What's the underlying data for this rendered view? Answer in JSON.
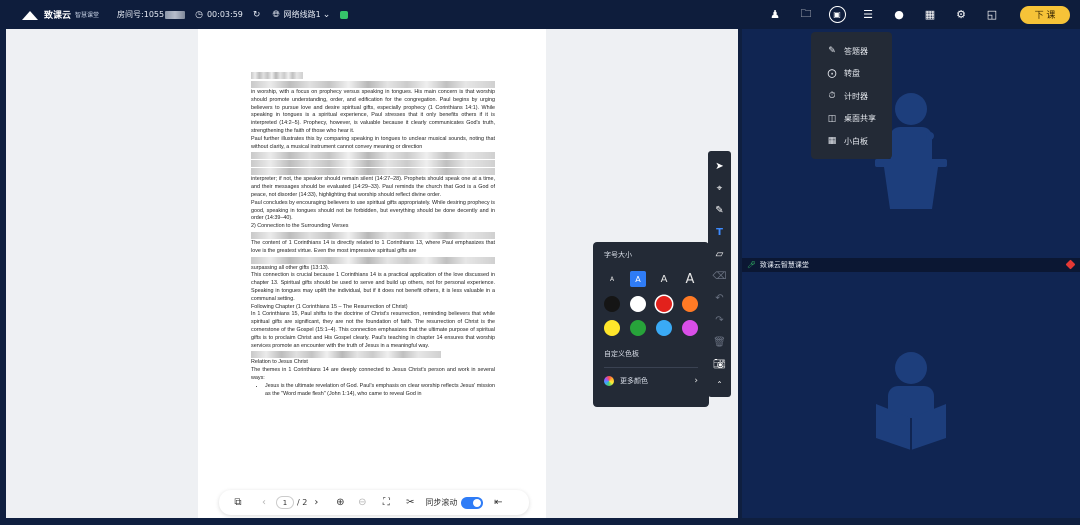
{
  "topbar": {
    "app_name": "致课云",
    "app_subtitle": "智慧课堂",
    "room_label": "房间号:1055",
    "timer": "00:03:59",
    "network_label": "网络线路1",
    "end_button": "下 课",
    "end_button_color": "#f6c338"
  },
  "document": {
    "paragraphs": [
      "in worship, with a focus on prophecy versus speaking in tongues. His main concern is that worship should promote understanding, order, and edification for the congregation. Paul begins by urging believers to pursue love and desire spiritual gifts, especially prophecy (1 Corinthians 14:1). While speaking in tongues is a spiritual experience, Paul stresses that it only benefits others if it is interpreted (14:2–5). Prophecy, however, is valuable because it clearly communicates God's truth, strengthening the faith of those who hear it.",
      "Paul further illustrates this by comparing speaking in tongues to unclear musical sounds, noting that without clarity, a musical instrument cannot convey meaning or direction",
      "interpreter; if not, the speaker should remain silent (14:27–28). Prophets should speak one at a time, and their messages should be evaluated (14:29–33). Paul reminds the church that God is a God of peace, not disorder (14:33), highlighting that worship should reflect divine order.",
      "Paul concludes by encouraging believers to use spiritual gifts appropriately. While desiring prophecy is good, speaking in tongues should not be forbidden, but everything should be done decently and in order (14:39–40).",
      "2) Connection to the Surrounding Verses",
      "The content of 1 Corinthians 14 is directly related to 1 Corinthians 13, where Paul emphasizes that love is the greatest virtue. Even the most impressive spiritual gifts are",
      "surpassing all other gifts (13:13).",
      "This connection is crucial because 1 Corinthians 14 is a practical application of the love discussed in chapter 13. Spiritual gifts should be used to serve and build up others, not for personal experience. Speaking in tongues may uplift the individual, but if it does not benefit others, it is less valuable in a communal setting.",
      "Following Chapter (1 Corinthians 15 – The Resurrection of Christ)",
      "In 1 Corinthians 15, Paul shifts to the doctrine of Christ's resurrection, reminding believers that while spiritual gifts are significant, they are not the foundation of faith. The resurrection of Christ is the cornerstone of the Gospel (15:1–4). This connection emphasizes that the ultimate purpose of spiritual gifts is to proclaim Christ and His Gospel clearly. Paul's teaching in chapter 14 ensures that worship services promote an encounter with the truth of Jesus in a meaningful way.",
      "Relation to Jesus Christ",
      "The themes in 1 Corinthians 14 are deeply connected to Jesus Christ's person and work in several ways:",
      "Jesus is the ultimate revelation of God. Paul's emphasis on clear worship reflects Jesus' mission as the \"Word made flesh\" (John 1:14), who came to reveal God in"
    ]
  },
  "pager": {
    "current_page": "1",
    "total_pages": "/ 2",
    "sync_scroll_label": "同步滚动",
    "sync_scroll_on": true
  },
  "text_popup": {
    "font_size_title": "字号大小",
    "size_options": [
      "A",
      "A",
      "A",
      "A"
    ],
    "selected_size_index": 1,
    "colors": [
      "#151515",
      "#ffffff",
      "#e2211c",
      "#ff7a25",
      "#ffe62b",
      "#27a33a",
      "#3aaaf5",
      "#d94ee8"
    ],
    "selected_color": "#e2211c",
    "custom_palette_label": "自定义色板",
    "more_colors_label": "更多颜色"
  },
  "tools_menu": {
    "items": [
      {
        "label": "答题器",
        "icon": "edit-square-icon"
      },
      {
        "label": "转盘",
        "icon": "wheel-icon"
      },
      {
        "label": "计时器",
        "icon": "stopwatch-icon"
      },
      {
        "label": "桌面共享",
        "icon": "desktop-share-icon"
      },
      {
        "label": "小白板",
        "icon": "whiteboard-icon"
      }
    ]
  },
  "right_panel": {
    "teacher_label": "致课云智慧课堂",
    "teacher_video_bg": "#102552",
    "student_video_bg": "#102552"
  }
}
